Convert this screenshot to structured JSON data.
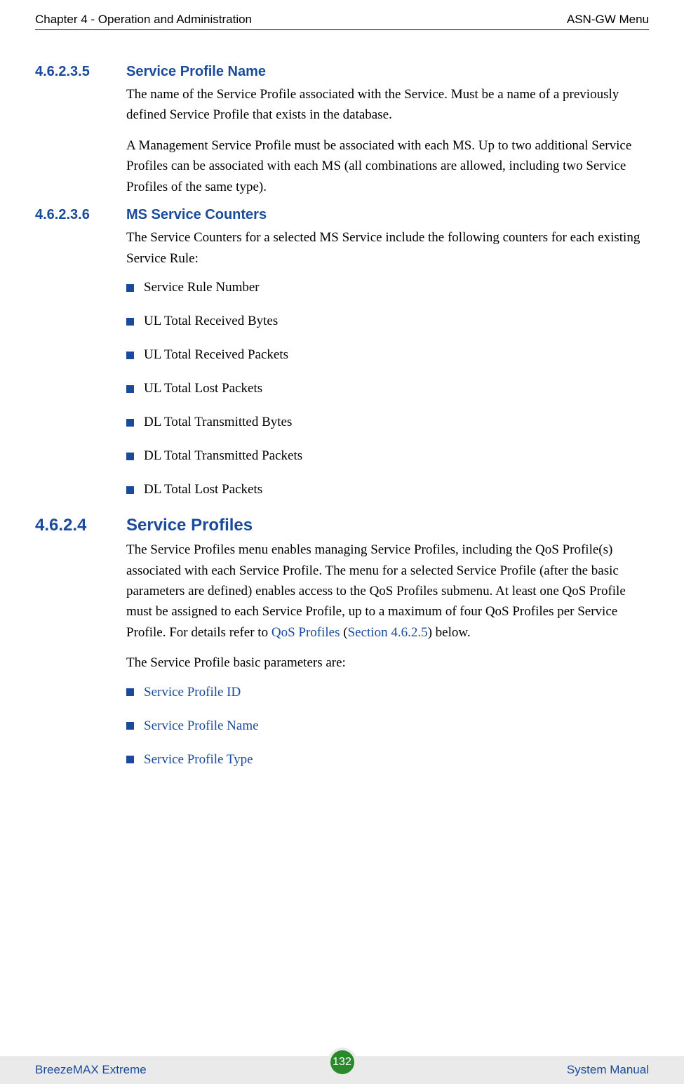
{
  "header": {
    "left": "Chapter 4 - Operation and Administration",
    "right": "ASN-GW Menu"
  },
  "sections": {
    "s1": {
      "num": "4.6.2.3.5",
      "title": "Service Profile Name",
      "p1": "The name of the Service Profile associated with the Service. Must be a name of a previously defined Service Profile that exists in the database.",
      "p2": "A Management Service Profile must be associated with each MS. Up to two additional Service Profiles can be associated with each MS (all combinations are allowed, including two Service Profiles of the same type)."
    },
    "s2": {
      "num": "4.6.2.3.6",
      "title": "MS Service Counters",
      "p1": "The Service Counters for a selected MS Service include the following counters for each existing Service Rule:",
      "bullets": [
        "Service Rule Number",
        "UL Total Received Bytes",
        "UL Total Received Packets",
        "UL Total Lost Packets",
        "DL Total Transmitted Bytes",
        "DL Total Transmitted Packets",
        "DL Total Lost Packets"
      ]
    },
    "s3": {
      "num": "4.6.2.4",
      "title": "Service Profiles",
      "p1_a": "The Service Profiles menu enables managing Service Profiles, including the QoS Profile(s) associated with each Service Profile. The menu for a selected Service Profile (after the basic parameters are defined) enables access to the QoS Profiles submenu. At least one QoS Profile must be assigned to each Service Profile, up to a maximum of four QoS Profiles per Service Profile. For details refer to ",
      "p1_link1": "QoS Profiles",
      "p1_b": " (",
      "p1_link2": "Section 4.6.2.5",
      "p1_c": ") below.",
      "p2": "The Service Profile basic parameters are:",
      "bullets": [
        "Service Profile ID",
        "Service Profile Name",
        "Service Profile Type"
      ]
    }
  },
  "footer": {
    "left": "BreezeMAX Extreme",
    "page": "132",
    "right": "System Manual"
  }
}
